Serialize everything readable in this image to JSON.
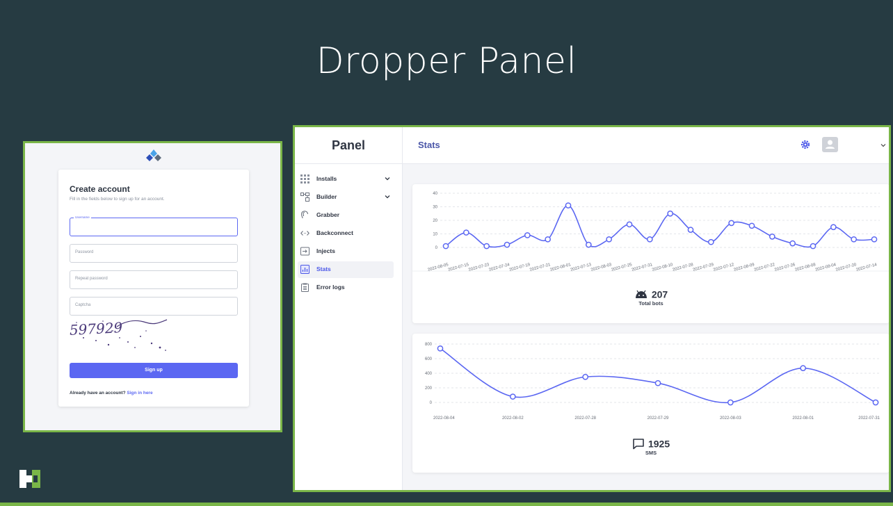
{
  "slide": {
    "title": "Dropper Panel"
  },
  "signup": {
    "title": "Create account",
    "subtitle": "Fill in the fields below to sign up for an account.",
    "username_label": "Username",
    "password_placeholder": "Password",
    "repeat_placeholder": "Repeat password",
    "captcha_placeholder": "Captcha",
    "captcha_text": "597929",
    "button": "Sign up",
    "already": "Already have an account?",
    "signin": "Sign in here"
  },
  "panel": {
    "brand": "Panel",
    "page_title": "Stats",
    "nav": [
      {
        "label": "Installs",
        "icon": "grid-icon",
        "has_chevron": true
      },
      {
        "label": "Builder",
        "icon": "builder-icon",
        "has_chevron": true
      },
      {
        "label": "Grabber",
        "icon": "ear-icon",
        "has_chevron": false
      },
      {
        "label": "Backconnect",
        "icon": "code-icon",
        "has_chevron": false
      },
      {
        "label": "Injects",
        "icon": "inject-icon",
        "has_chevron": false
      },
      {
        "label": "Stats",
        "icon": "stats-icon",
        "has_chevron": false,
        "active": true
      },
      {
        "label": "Error logs",
        "icon": "clipboard-icon",
        "has_chevron": false
      }
    ]
  },
  "bots_stat": {
    "value": "207",
    "label": "Total bots",
    "icon": "android-icon"
  },
  "sms_stat": {
    "value": "1925",
    "label": "SMS",
    "icon": "message-icon"
  },
  "colors": {
    "accent": "#5b67f2",
    "frame": "#7ab648",
    "background": "#263b42"
  },
  "chart_data": [
    {
      "type": "line",
      "categories": [
        "2022-08-05",
        "2022-07-15",
        "2022-07-23",
        "2022-07-24",
        "2022-07-19",
        "2022-07-21",
        "2022-08-01",
        "2022-07-13",
        "2022-08-03",
        "2022-07-25",
        "2022-07-31",
        "2022-08-10",
        "2022-07-28",
        "2022-07-29",
        "2022-07-12",
        "2022-08-09",
        "2022-07-22",
        "2022-07-26",
        "2022-08-08",
        "2022-08-04",
        "2022-07-20",
        "2022-07-14"
      ],
      "values": [
        1,
        11,
        1,
        2,
        9,
        6,
        31,
        2,
        6,
        17,
        6,
        25,
        13,
        4,
        18,
        16,
        8,
        3,
        1,
        15,
        6,
        6
      ],
      "ylim": [
        0,
        40
      ],
      "yticks": [
        0,
        10,
        20,
        30,
        40
      ],
      "grid": true
    },
    {
      "type": "line",
      "categories": [
        "2022-08-04",
        "2022-08-02",
        "2022-07-28",
        "2022-07-29",
        "2022-08-03",
        "2022-08-01",
        "2022-07-31"
      ],
      "values": [
        740,
        80,
        350,
        265,
        0,
        470,
        0
      ],
      "ylim": [
        0,
        800
      ],
      "yticks": [
        0,
        200,
        400,
        600,
        800
      ],
      "grid": true
    }
  ]
}
